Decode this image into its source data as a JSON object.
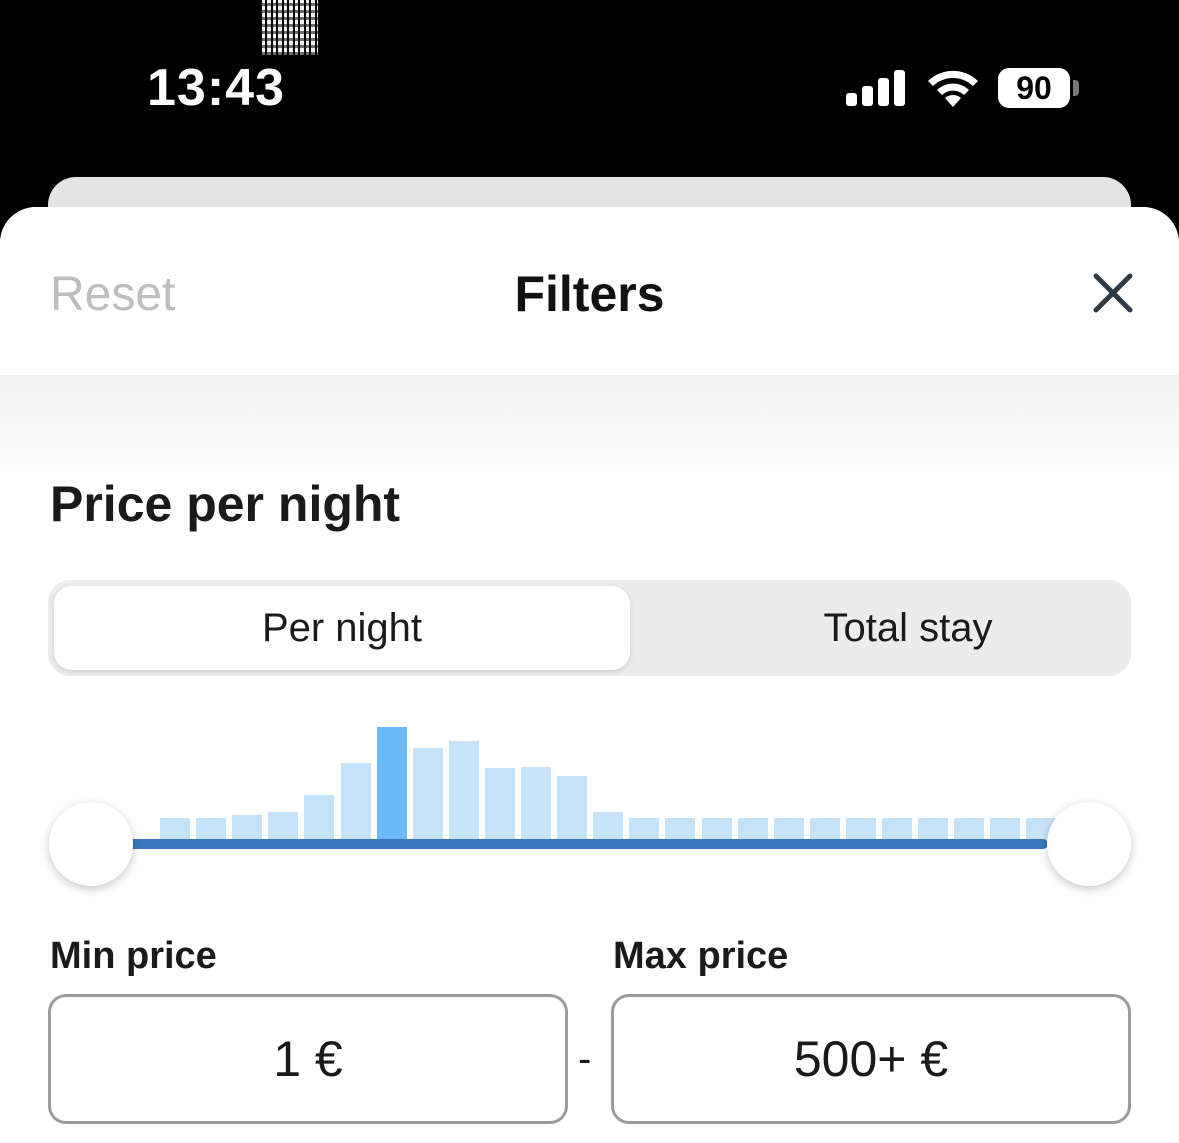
{
  "status_bar": {
    "time": "13:43",
    "battery": "90",
    "icons": [
      "signal-icon",
      "wifi-icon",
      "battery-icon"
    ]
  },
  "header": {
    "reset_label": "Reset",
    "title": "Filters",
    "close_icon": "close-icon"
  },
  "price": {
    "section_title": "Price per night",
    "tabs": [
      {
        "label": "Per night",
        "selected": true
      },
      {
        "label": "Total stay",
        "selected": false
      }
    ],
    "histogram": {
      "relative_heights": [
        0.2,
        0.2,
        0.23,
        0.25,
        0.4,
        0.68,
        1.0,
        0.82,
        0.88,
        0.64,
        0.65,
        0.57,
        0.25,
        0.2,
        0.2,
        0.2,
        0.2,
        0.2,
        0.2,
        0.2,
        0.2,
        0.2,
        0.2,
        0.2,
        0.2,
        0.2
      ],
      "highlighted_index": 6
    },
    "slider": {
      "min_position": 0.0,
      "max_position": 1.0
    },
    "min_label": "Min price",
    "max_label": "Max price",
    "min_value": "1 €",
    "max_value": "500+ €",
    "separator": "-"
  },
  "colors": {
    "accent": "#3a78be",
    "bar": "#c7e3fa",
    "bar_highlight": "#6db8f6"
  }
}
